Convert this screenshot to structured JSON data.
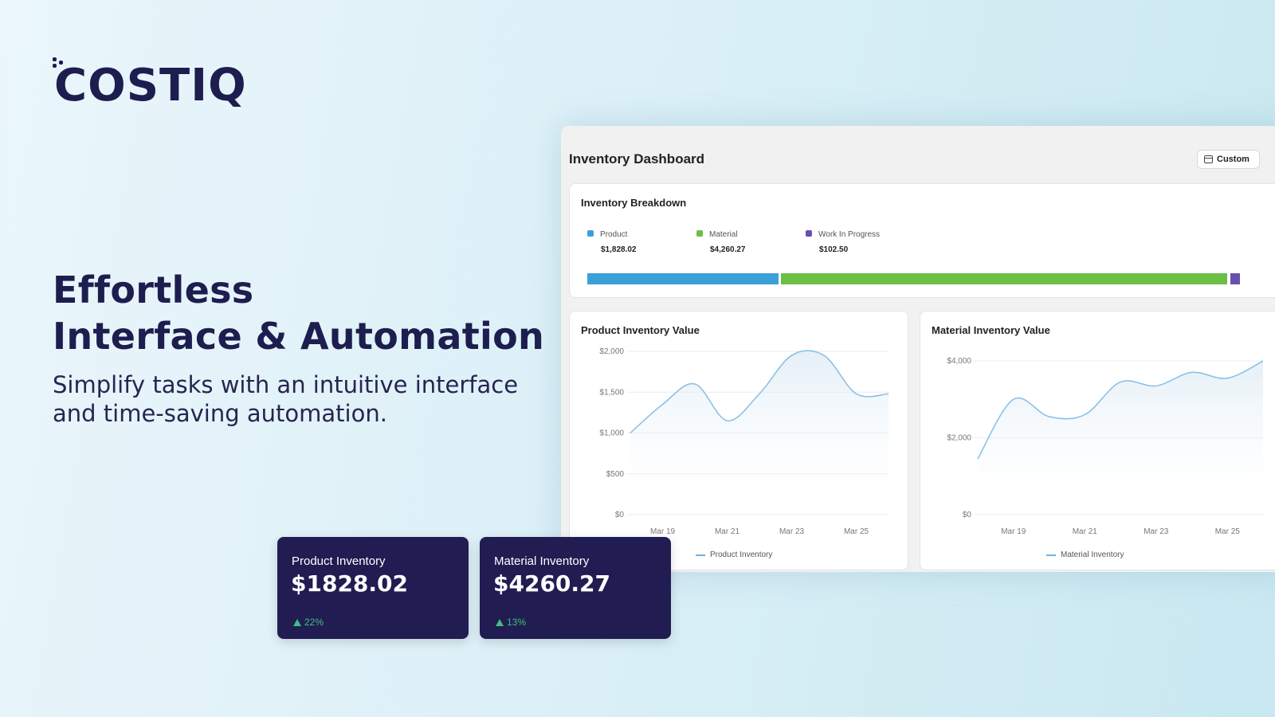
{
  "brand": {
    "logo_text": "COSTIQ"
  },
  "hero": {
    "title_line1": "Effortless",
    "title_line2": "Interface & Automation",
    "subtitle_line1": "Simplify tasks with an intuitive interface",
    "subtitle_line2": "and time-saving automation."
  },
  "dashboard": {
    "title": "Inventory Dashboard",
    "custom_button": "Custom",
    "breakdown": {
      "title": "Inventory Breakdown",
      "items": [
        {
          "label": "Product",
          "value": "$1,828.02",
          "color": "#3aa0d8"
        },
        {
          "label": "Material",
          "value": "$4,260.27",
          "color": "#6cbf45"
        },
        {
          "label": "Work In Progress",
          "value": "$102.50",
          "color": "#6a4fb0"
        }
      ]
    }
  },
  "chart_data": [
    {
      "type": "line",
      "title": "Product Inventory Value",
      "x": [
        "Mar 18",
        "Mar 19",
        "Mar 20",
        "Mar 21",
        "Mar 22",
        "Mar 23",
        "Mar 24",
        "Mar 25",
        "Mar 26"
      ],
      "series": [
        {
          "name": "Product Inventory",
          "values": [
            1000,
            1350,
            1600,
            1150,
            1480,
            1950,
            1950,
            1480,
            1480
          ]
        }
      ],
      "xticks": [
        "Mar 19",
        "Mar 21",
        "Mar 23",
        "Mar 25"
      ],
      "yticks": [
        "$0",
        "$500",
        "$1,000",
        "$1,500",
        "$2,000"
      ],
      "ylim": [
        0,
        2000
      ],
      "color": "#8cc1e6"
    },
    {
      "type": "line",
      "title": "Material Inventory Value",
      "x": [
        "Mar 18",
        "Mar 19",
        "Mar 20",
        "Mar 21",
        "Mar 22",
        "Mar 23",
        "Mar 24",
        "Mar 25",
        "Mar 26"
      ],
      "series": [
        {
          "name": "Material Inventory",
          "values": [
            1450,
            3000,
            2550,
            2600,
            3450,
            3350,
            3700,
            3550,
            4000
          ]
        }
      ],
      "xticks": [
        "Mar 19",
        "Mar 21",
        "Mar 23",
        "Mar 25"
      ],
      "yticks": [
        "$0",
        "$2,000",
        "$4,000"
      ],
      "ylim": [
        0,
        4000
      ],
      "color": "#8cc1e6"
    }
  ],
  "stats": [
    {
      "label": "Product Inventory",
      "value": "$1828.02",
      "delta": "22%"
    },
    {
      "label": "Material Inventory",
      "value": "$4260.27",
      "delta": "13%"
    }
  ]
}
